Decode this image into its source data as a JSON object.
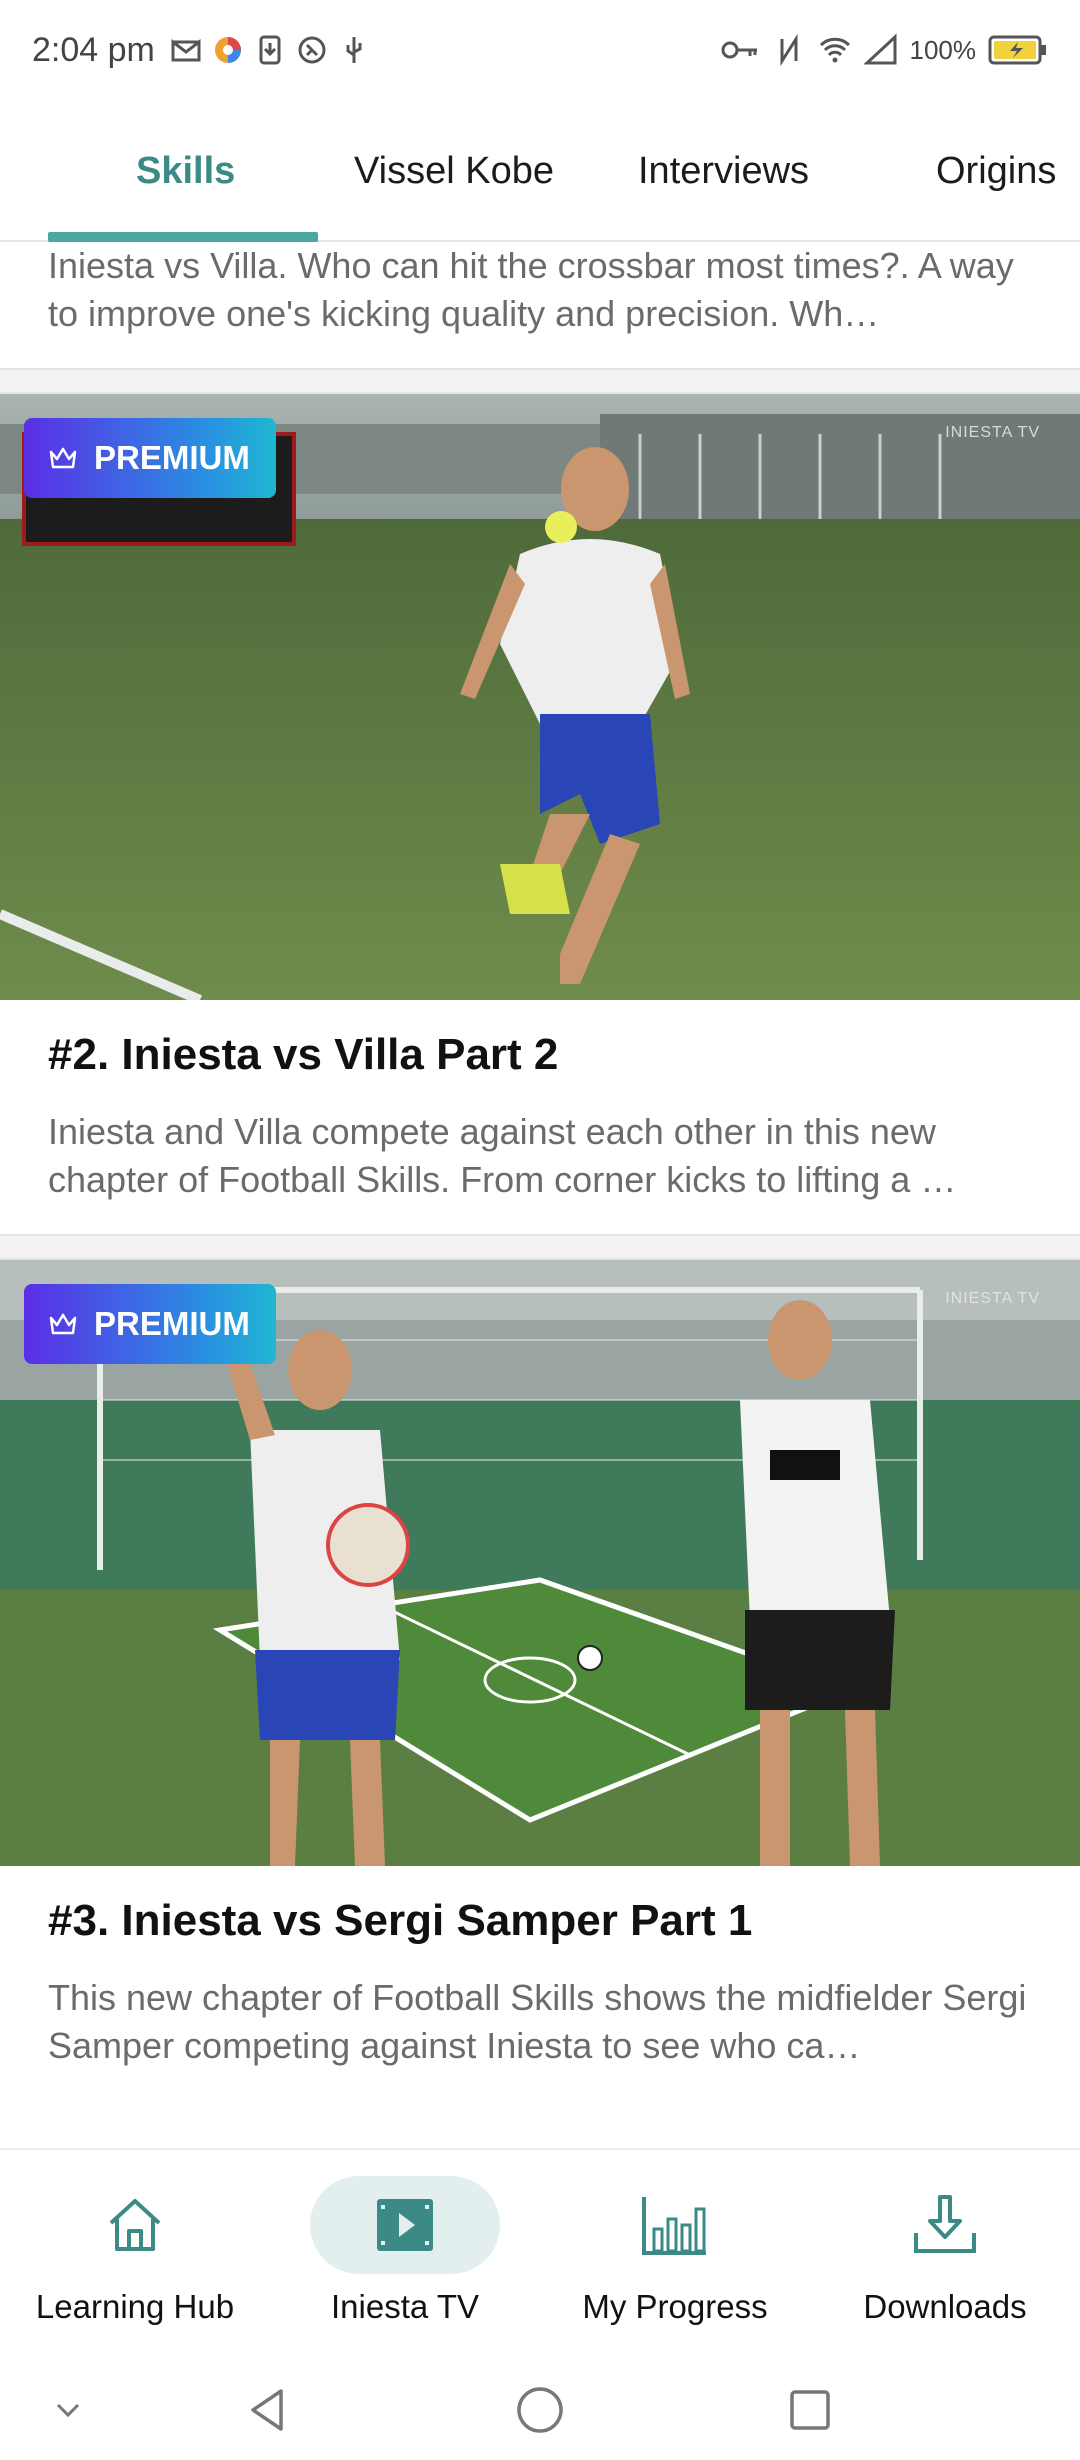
{
  "status_bar": {
    "time": "2:04 pm",
    "battery": "100%"
  },
  "tabs": [
    {
      "label": "Skills",
      "active": true
    },
    {
      "label": "Vissel Kobe",
      "active": false
    },
    {
      "label": "Interviews",
      "active": false
    },
    {
      "label": "Origins",
      "active": false
    }
  ],
  "cards": [
    {
      "description": "Iniesta vs Villa. Who can hit the crossbar most times?. A way to improve one's kicking quality and precision. Wh…",
      "partial": true
    },
    {
      "badge": "PREMIUM",
      "title": "#2. Iniesta vs Villa Part 2",
      "description": "Iniesta and Villa compete against each other in this new chapter of Football Skills. From corner kicks to lifting a …",
      "watermark": "INIESTA TV"
    },
    {
      "badge": "PREMIUM",
      "title": "#3. Iniesta vs Sergi Samper Part 1",
      "description": "This new chapter of Football Skills shows the midfielder Sergi Samper competing against Iniesta to see who ca…",
      "watermark": "INIESTA TV"
    }
  ],
  "bottom_nav": [
    {
      "label": "Learning Hub",
      "icon": "home-icon",
      "active": false
    },
    {
      "label": "Iniesta TV",
      "icon": "video-icon",
      "active": true
    },
    {
      "label": "My Progress",
      "icon": "bar-chart-icon",
      "active": false
    },
    {
      "label": "Downloads",
      "icon": "download-icon",
      "active": false
    }
  ],
  "colors": {
    "accent": "#3c8a86",
    "premium_gradient_start": "#5b2ee6",
    "premium_gradient_end": "#1fb7d2"
  }
}
